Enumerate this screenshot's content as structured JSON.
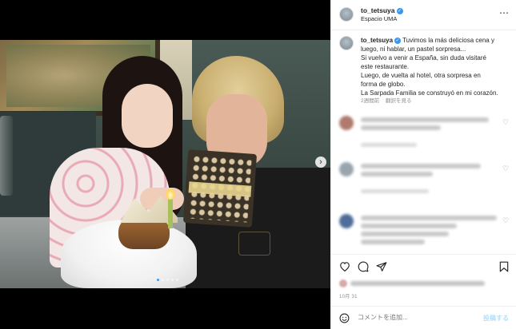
{
  "post": {
    "username": "to_tetsuya",
    "verified_mark": "✓",
    "location": "Espacio UMA",
    "more_icon": "⋯"
  },
  "caption": {
    "username": "to_tetsuya",
    "lines": [
      "Tuvimos la más deliciosa cena y",
      "luego, ni hablar, un pastel sorpresa...",
      "Si vuelvo a venir a España, sin duda visitaré",
      "este restaurante.",
      "Luego, de vuelta al hotel, otra sorpresa en",
      "forma de globo.",
      "La Sarpada Familia se construyó en mi corazón."
    ],
    "time_ago": "2週間前",
    "see_translation": "翻訳を見る"
  },
  "comments_blurred": [
    {
      "avatar_color": "#b07a6e"
    },
    {
      "avatar_color": "#9aa4ad"
    },
    {
      "avatar_color": "#4f6d9a"
    }
  ],
  "actions": {
    "like_icon": "heart-icon",
    "comment_icon": "comment-icon",
    "share_icon": "share-icon",
    "save_icon": "bookmark-icon"
  },
  "date": "10月 31",
  "comment_box": {
    "placeholder": "コメントを追加...",
    "post_label": "投稿する"
  },
  "carousel": {
    "slide_count": 5,
    "active_index": 0,
    "next_glyph": "›"
  }
}
